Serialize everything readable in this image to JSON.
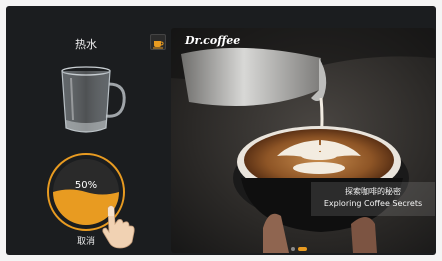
{
  "left_panel": {
    "title": "热水",
    "progress_percent": 50,
    "progress_label": "50%",
    "cancel_label": "取消"
  },
  "banner": {
    "brand": "Dr.coffee",
    "caption_cn": "探索咖啡的秘密",
    "caption_en": "Exploring Coffee Secrets",
    "slide_count": 2,
    "active_slide": 1
  },
  "colors": {
    "accent": "#e89b21",
    "background": "#1b1d1f"
  },
  "icons": {
    "mode_button": "coffee-cup-icon",
    "glass": "glass-mug-icon",
    "pointer": "hand-pointer-icon"
  }
}
